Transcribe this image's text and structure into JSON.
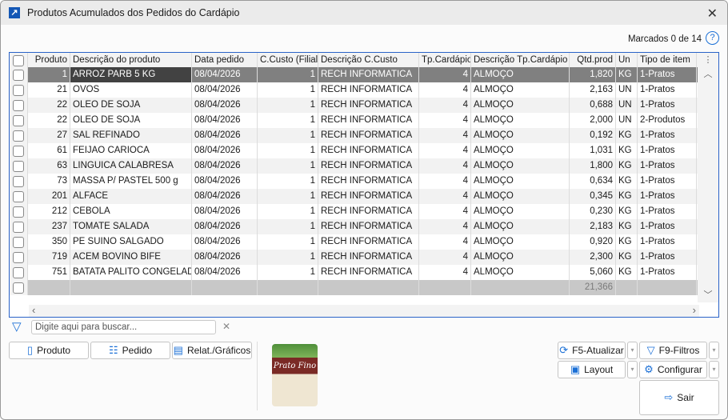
{
  "window": {
    "title": "Produtos Acumulados dos Pedidos do Cardápio"
  },
  "marked": "Marcados 0 de 14",
  "columns": [
    "Produto",
    "Descrição do produto",
    "Data pedido",
    "C.Custo (Filial)",
    "Descrição C.Custo",
    "Tp.Cardápio",
    "Descrição Tp.Cardápio",
    "Qtd.prod",
    "Un",
    "Tipo de item"
  ],
  "rows": [
    [
      "1",
      "ARROZ PARB 5 KG",
      "08/04/2026",
      "1",
      "RECH INFORMATICA",
      "4",
      "ALMOÇO",
      "1,820",
      "KG",
      "1-Pratos"
    ],
    [
      "21",
      "OVOS",
      "08/04/2026",
      "1",
      "RECH INFORMATICA",
      "4",
      "ALMOÇO",
      "2,163",
      "UN",
      "1-Pratos"
    ],
    [
      "22",
      "OLEO DE SOJA",
      "08/04/2026",
      "1",
      "RECH INFORMATICA",
      "4",
      "ALMOÇO",
      "0,688",
      "UN",
      "1-Pratos"
    ],
    [
      "22",
      "OLEO DE SOJA",
      "08/04/2026",
      "1",
      "RECH INFORMATICA",
      "4",
      "ALMOÇO",
      "2,000",
      "UN",
      "2-Produtos"
    ],
    [
      "27",
      "SAL REFINADO",
      "08/04/2026",
      "1",
      "RECH INFORMATICA",
      "4",
      "ALMOÇO",
      "0,192",
      "KG",
      "1-Pratos"
    ],
    [
      "61",
      "FEIJAO CARIOCA",
      "08/04/2026",
      "1",
      "RECH INFORMATICA",
      "4",
      "ALMOÇO",
      "1,031",
      "KG",
      "1-Pratos"
    ],
    [
      "63",
      "LINGUICA CALABRESA",
      "08/04/2026",
      "1",
      "RECH INFORMATICA",
      "4",
      "ALMOÇO",
      "1,800",
      "KG",
      "1-Pratos"
    ],
    [
      "73",
      "MASSA P/ PASTEL 500 g",
      "08/04/2026",
      "1",
      "RECH INFORMATICA",
      "4",
      "ALMOÇO",
      "0,634",
      "KG",
      "1-Pratos"
    ],
    [
      "201",
      "ALFACE",
      "08/04/2026",
      "1",
      "RECH INFORMATICA",
      "4",
      "ALMOÇO",
      "0,345",
      "KG",
      "1-Pratos"
    ],
    [
      "212",
      "CEBOLA",
      "08/04/2026",
      "1",
      "RECH INFORMATICA",
      "4",
      "ALMOÇO",
      "0,230",
      "KG",
      "1-Pratos"
    ],
    [
      "237",
      "TOMATE SALADA",
      "08/04/2026",
      "1",
      "RECH INFORMATICA",
      "4",
      "ALMOÇO",
      "2,183",
      "KG",
      "1-Pratos"
    ],
    [
      "350",
      "PE SUINO SALGADO",
      "08/04/2026",
      "1",
      "RECH INFORMATICA",
      "4",
      "ALMOÇO",
      "0,920",
      "KG",
      "1-Pratos"
    ],
    [
      "719",
      " ACEM BOVINO  BIFE",
      "08/04/2026",
      "1",
      "RECH INFORMATICA",
      "4",
      "ALMOÇO",
      "2,300",
      "KG",
      "1-Pratos"
    ],
    [
      "751",
      "BATATA PALITO CONGELADA",
      "08/04/2026",
      "1",
      "RECH INFORMATICA",
      "4",
      "ALMOÇO",
      "5,060",
      "KG",
      "1-Pratos"
    ]
  ],
  "total": "21,366",
  "search": {
    "placeholder": "Digite aqui para buscar..."
  },
  "buttons": {
    "produto": "Produto",
    "pedido": "Pedido",
    "relat": "Relat./Gráficos",
    "atualizar": "F5-Atualizar",
    "filtros": "F9-Filtros",
    "layout": "Layout",
    "configurar": "Configurar",
    "sair": "Sair"
  },
  "product_image": {
    "brand": "Prato Fino"
  }
}
